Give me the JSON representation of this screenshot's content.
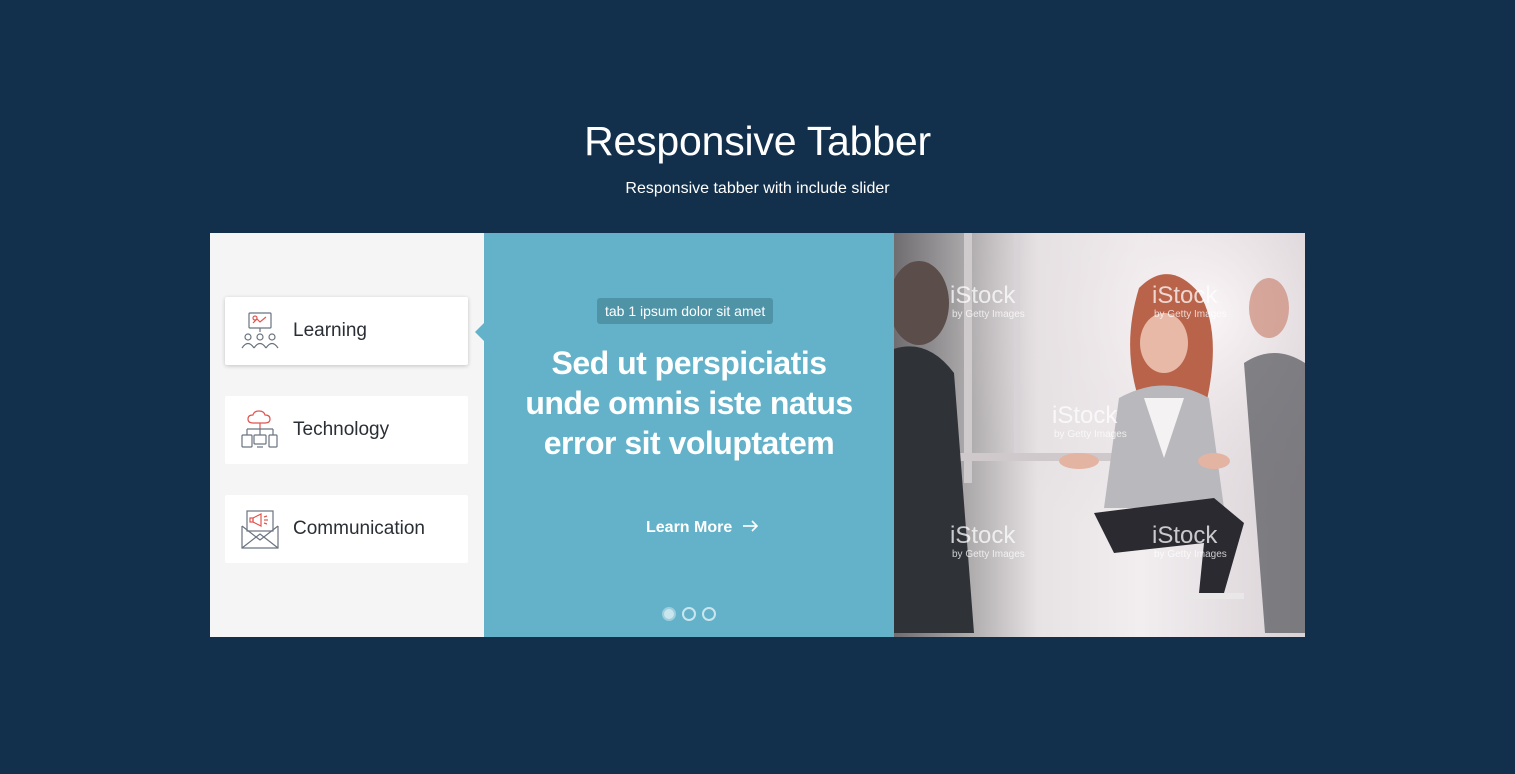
{
  "header": {
    "title": "Responsive Tabber",
    "subtitle": "Responsive tabber with include slider"
  },
  "tabs": [
    {
      "label": "Learning",
      "icon": "presentation-icon",
      "active": true
    },
    {
      "label": "Technology",
      "icon": "network-devices-icon",
      "active": false
    },
    {
      "label": "Communication",
      "icon": "megaphone-envelope-icon",
      "active": false
    }
  ],
  "content": {
    "tag": "tab 1 ipsum dolor sit amet",
    "headline": "Sed ut perspiciatis unde omnis iste natus error sit voluptatem",
    "learn_more": "Learn More",
    "slide_count": 3,
    "active_slide": 1
  },
  "photo": {
    "watermark": "iStock",
    "watermark_sub": "by Getty Images"
  },
  "colors": {
    "background": "#12304c",
    "panel": "#64b2c9",
    "tab_list_bg": "#f5f5f5"
  }
}
